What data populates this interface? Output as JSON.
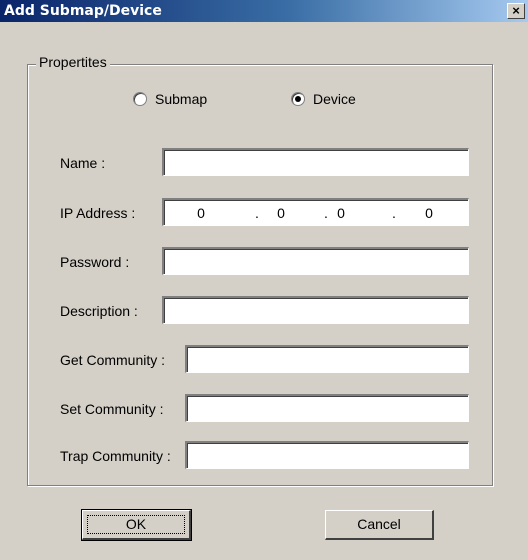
{
  "window": {
    "title": "Add Submap/Device",
    "close_label": "×"
  },
  "group": {
    "label": "Propertites"
  },
  "type_options": [
    {
      "label": "Submap",
      "selected": false
    },
    {
      "label": "Device",
      "selected": true
    }
  ],
  "fields": {
    "name": {
      "label": "Name :",
      "value": ""
    },
    "ip": {
      "label": "IP Address :",
      "octets": [
        "0",
        "0",
        "0",
        "0"
      ],
      "separator": "."
    },
    "password": {
      "label": "Password :",
      "value": ""
    },
    "description": {
      "label": "Description :",
      "value": ""
    },
    "get_community": {
      "label": "Get Community :",
      "value": ""
    },
    "set_community": {
      "label": "Set Community :",
      "value": ""
    },
    "trap_community": {
      "label": "Trap Community :",
      "value": ""
    }
  },
  "buttons": {
    "ok": "OK",
    "cancel": "Cancel"
  }
}
